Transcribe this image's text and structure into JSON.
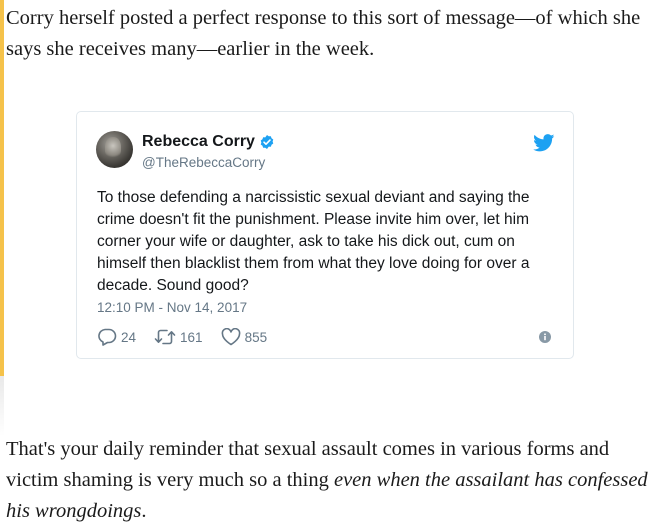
{
  "article": {
    "paragraph_1": "Corry herself posted a perfect response to this sort of message—of which she says she receives many—earlier in the week.",
    "paragraph_2_plain": "That's your daily reminder that sexual assault comes in various forms and victim shaming is very much so a thing ",
    "paragraph_2_italic": "even when the assailant has confessed his wrongdoings",
    "paragraph_2_end": "."
  },
  "tweet": {
    "display_name": "Rebecca Corry",
    "handle": "@TheRebeccaCorry",
    "text": "To those defending a narcissistic sexual deviant and saying the crime doesn't fit the punishment. Please invite him over, let him corner your wife or daughter, ask to take his dick out, cum on himself then blacklist them from what they love doing for over a decade. Sound good?",
    "timestamp": "12:10 PM - Nov 14, 2017",
    "replies": "24",
    "retweets": "161",
    "likes": "855"
  },
  "icons": {
    "verified": "verified-badge-icon",
    "bird": "twitter-bird-icon",
    "reply": "reply-icon",
    "retweet": "retweet-icon",
    "like": "heart-icon",
    "info": "info-icon"
  },
  "colors": {
    "accent_bar": "#f5c24a",
    "twitter_blue": "#1da1f2",
    "muted_text": "#657786"
  }
}
